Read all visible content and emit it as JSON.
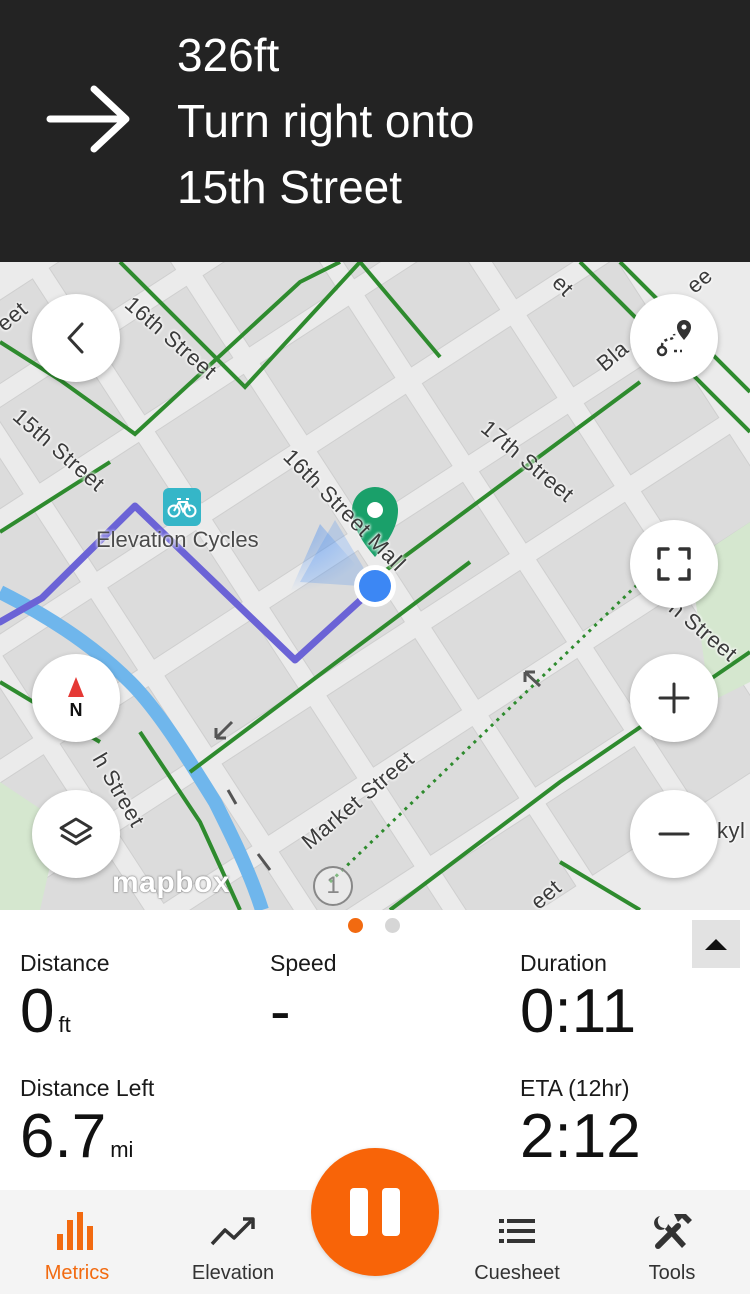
{
  "navigation": {
    "distance": "326ft",
    "instruction_line1": "Turn right onto",
    "instruction_line2": "15th Street",
    "maneuver_icon": "arrow-right-icon"
  },
  "map": {
    "streets": {
      "s16th_top": "16th Street",
      "s15th_left": "15th Street",
      "s16th_mall": "16th Street Mall",
      "s17th": "17th Street",
      "market": "Market Street",
      "s15th_bottom": "h Street",
      "s18th_right": "h Street",
      "blake": "Bla",
      "top_partial": "et",
      "top_partial2": "ee",
      "bottom_partial": "eet",
      "left_partial": "eet",
      "right_edge": "kyl"
    },
    "poi_name": "Elevation Cycles",
    "poi_icon": "bicycle-icon",
    "brand": "mapbox",
    "attribution_symbol": "1",
    "compass_label": "N",
    "colors": {
      "route": "#6b63d6",
      "bike_lane": "#2e8b2e",
      "water": "#6fb6ec",
      "user_location": "#3c87f4",
      "destination_pin": "#1aa06a"
    }
  },
  "metrics": {
    "distance": {
      "label": "Distance",
      "value": "0",
      "unit": "ft"
    },
    "speed": {
      "label": "Speed",
      "value": "-"
    },
    "duration": {
      "label": "Duration",
      "value": "0:11"
    },
    "distance_left": {
      "label": "Distance Left",
      "value": "6.7",
      "unit": "mi"
    },
    "eta": {
      "label": "ETA (12hr)",
      "value": "2:12"
    },
    "page_indicator": {
      "pages": 2,
      "active": 1
    }
  },
  "tabs": [
    {
      "label": "Metrics",
      "icon": "bar-chart-icon",
      "active": true
    },
    {
      "label": "Elevation",
      "icon": "trend-line-icon",
      "active": false
    },
    {
      "label": "Cuesheet",
      "icon": "list-icon",
      "active": false
    },
    {
      "label": "Tools",
      "icon": "tools-icon",
      "active": false
    }
  ],
  "accent_color": "#f26a10"
}
